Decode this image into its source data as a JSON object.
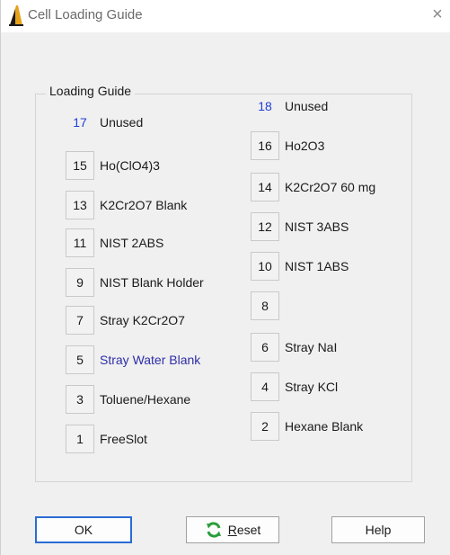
{
  "window": {
    "title": "Cell Loading Guide",
    "close_glyph": "×"
  },
  "group": {
    "label": "Loading Guide"
  },
  "colors": {
    "highlight_text": "#2e2ea8",
    "number_blue": "#1f3fd6",
    "ok_border": "#2b6cd4",
    "reset_icon_green": "#2a9d3a"
  },
  "left_slots": [
    {
      "number": "17",
      "label": "Unused",
      "boxed": false,
      "number_color": "blue"
    },
    {
      "number": "15",
      "label": "Ho(ClO4)3",
      "boxed": true
    },
    {
      "number": "13",
      "label": "K2Cr2O7 Blank",
      "boxed": true
    },
    {
      "number": "11",
      "label": "NIST 2ABS",
      "boxed": true
    },
    {
      "number": "9",
      "label": "NIST Blank Holder",
      "boxed": true
    },
    {
      "number": "7",
      "label": "Stray K2Cr2O7",
      "boxed": true
    },
    {
      "number": "5",
      "label": "Stray Water Blank",
      "boxed": true,
      "highlighted": true
    },
    {
      "number": "3",
      "label": "Toluene/Hexane",
      "boxed": true
    },
    {
      "number": "1",
      "label": "FreeSlot",
      "boxed": true
    }
  ],
  "right_slots": [
    {
      "number": "18",
      "label": "Unused",
      "boxed": false,
      "number_color": "blue"
    },
    {
      "number": "16",
      "label": "Ho2O3",
      "boxed": true
    },
    {
      "number": "14",
      "label": "K2Cr2O7 60 mg",
      "boxed": true
    },
    {
      "number": "12",
      "label": "NIST 3ABS",
      "boxed": true
    },
    {
      "number": "10",
      "label": "NIST 1ABS",
      "boxed": true
    },
    {
      "number": "8",
      "label": "",
      "boxed": true
    },
    {
      "number": "6",
      "label": "Stray NaI",
      "boxed": true
    },
    {
      "number": "4",
      "label": "Stray KCl",
      "boxed": true
    },
    {
      "number": "2",
      "label": "Hexane Blank",
      "boxed": true
    }
  ],
  "buttons": {
    "ok": "OK",
    "reset_mnemonic": "R",
    "reset_rest": "eset",
    "help": "Help"
  },
  "icons": {
    "app": "flask-icon",
    "close": "close-icon",
    "reset": "refresh-icon"
  }
}
